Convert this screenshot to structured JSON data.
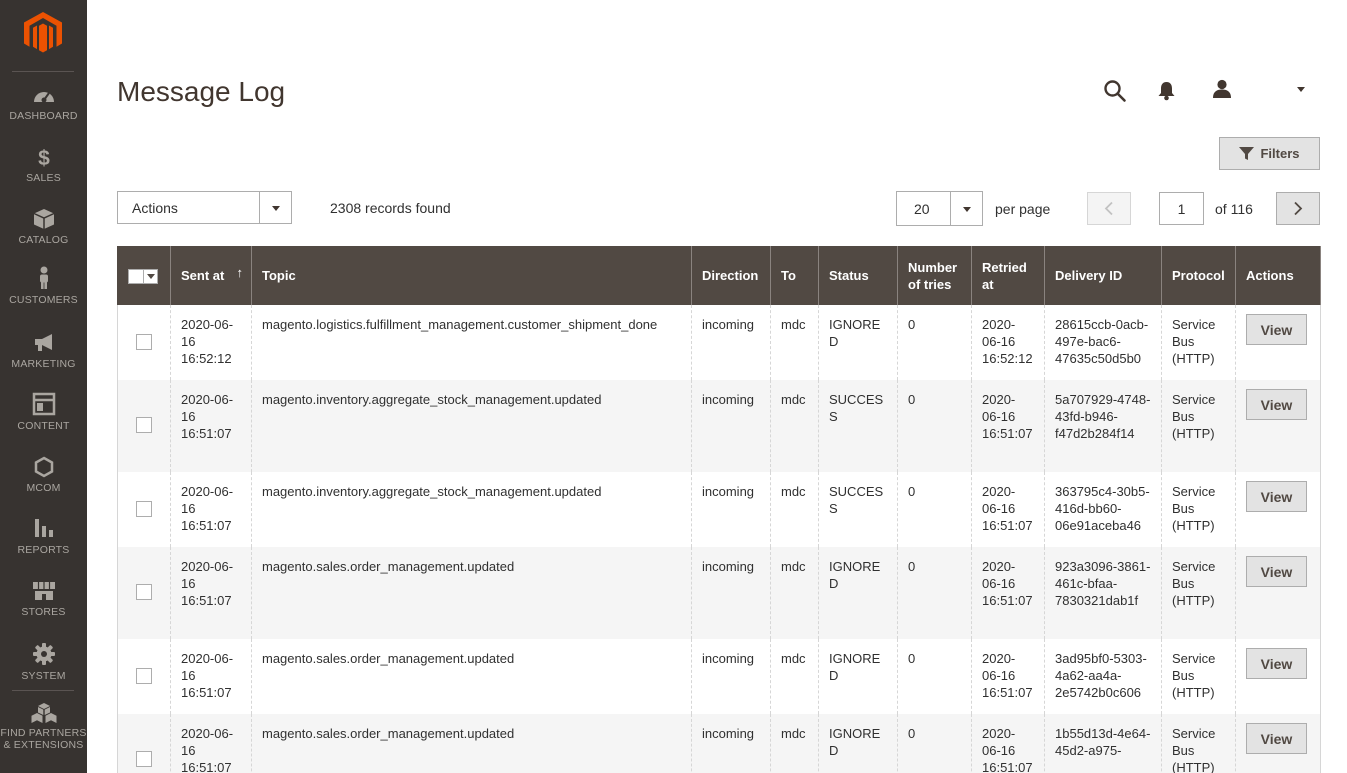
{
  "sidebar": {
    "items": [
      {
        "label": "DASHBOARD",
        "icon": "dashboard-icon"
      },
      {
        "label": "SALES",
        "icon": "dollar-icon"
      },
      {
        "label": "CATALOG",
        "icon": "box-icon"
      },
      {
        "label": "CUSTOMERS",
        "icon": "person-icon"
      },
      {
        "label": "MARKETING",
        "icon": "megaphone-icon"
      },
      {
        "label": "CONTENT",
        "icon": "layout-icon"
      },
      {
        "label": "MCOM",
        "icon": "hexagon-icon"
      },
      {
        "label": "REPORTS",
        "icon": "bar-chart-icon"
      },
      {
        "label": "STORES",
        "icon": "store-icon"
      },
      {
        "label": "SYSTEM",
        "icon": "gear-icon"
      },
      {
        "label": "FIND PARTNERS",
        "label2": "& EXTENSIONS",
        "icon": "cubes-icon"
      }
    ]
  },
  "header": {
    "title": "Message Log"
  },
  "toolbar": {
    "filters_label": "Filters",
    "actions_label": "Actions",
    "records_found": "2308 records found",
    "per_page_value": "20",
    "per_page_label": "per page",
    "current_page": "1",
    "page_of": "of 116"
  },
  "table": {
    "columns": [
      "Sent at",
      "Topic",
      "Direction",
      "To",
      "Status",
      "Number of tries",
      "Retried at",
      "Delivery ID",
      "Protocol",
      "Actions"
    ],
    "rows": [
      {
        "sent_at": "2020-06-16 16:52:12",
        "topic": "magento.logistics.fulfillment_management.customer_shipment_done",
        "direction": "incoming",
        "to": "mdc",
        "status": "IGNORED",
        "tries": "0",
        "retried_at": "2020-06-16 16:52:12",
        "delivery_id": "28615ccb-0acb-497e-bac6-47635c50d5b0",
        "protocol": "Service Bus (HTTP)",
        "action": "View"
      },
      {
        "sent_at": "2020-06-16 16:51:07",
        "topic": "magento.inventory.aggregate_stock_management.updated",
        "direction": "incoming",
        "to": "mdc",
        "status": "SUCCESS",
        "tries": "0",
        "retried_at": "2020-06-16 16:51:07",
        "delivery_id": "5a707929-4748-43fd-b946-f47d2b284f14",
        "protocol": "Service Bus (HTTP)",
        "action": "View"
      },
      {
        "sent_at": "2020-06-16 16:51:07",
        "topic": "magento.inventory.aggregate_stock_management.updated",
        "direction": "incoming",
        "to": "mdc",
        "status": "SUCCESS",
        "tries": "0",
        "retried_at": "2020-06-16 16:51:07",
        "delivery_id": "363795c4-30b5-416d-bb60-06e91aceba46",
        "protocol": "Service Bus (HTTP)",
        "action": "View"
      },
      {
        "sent_at": "2020-06-16 16:51:07",
        "topic": "magento.sales.order_management.updated",
        "direction": "incoming",
        "to": "mdc",
        "status": "IGNORED",
        "tries": "0",
        "retried_at": "2020-06-16 16:51:07",
        "delivery_id": "923a3096-3861-461c-bfaa-7830321dab1f",
        "protocol": "Service Bus (HTTP)",
        "action": "View"
      },
      {
        "sent_at": "2020-06-16 16:51:07",
        "topic": "magento.sales.order_management.updated",
        "direction": "incoming",
        "to": "mdc",
        "status": "IGNORED",
        "tries": "0",
        "retried_at": "2020-06-16 16:51:07",
        "delivery_id": "3ad95bf0-5303-4a62-aa4a-2e5742b0c606",
        "protocol": "Service Bus (HTTP)",
        "action": "View"
      },
      {
        "sent_at": "2020-06-16 16:51:07",
        "topic": "magento.sales.order_management.updated",
        "direction": "incoming",
        "to": "mdc",
        "status": "IGNORED",
        "tries": "0",
        "retried_at": "2020-06-16 16:51:07",
        "delivery_id": "1b55d13d-4e64-45d2-a975-",
        "protocol": "Service Bus (HTTP)",
        "action": "View"
      }
    ]
  },
  "colors": {
    "sidebar_bg": "#373330",
    "logo_orange": "#eb5202",
    "table_header_bg": "#514943"
  }
}
